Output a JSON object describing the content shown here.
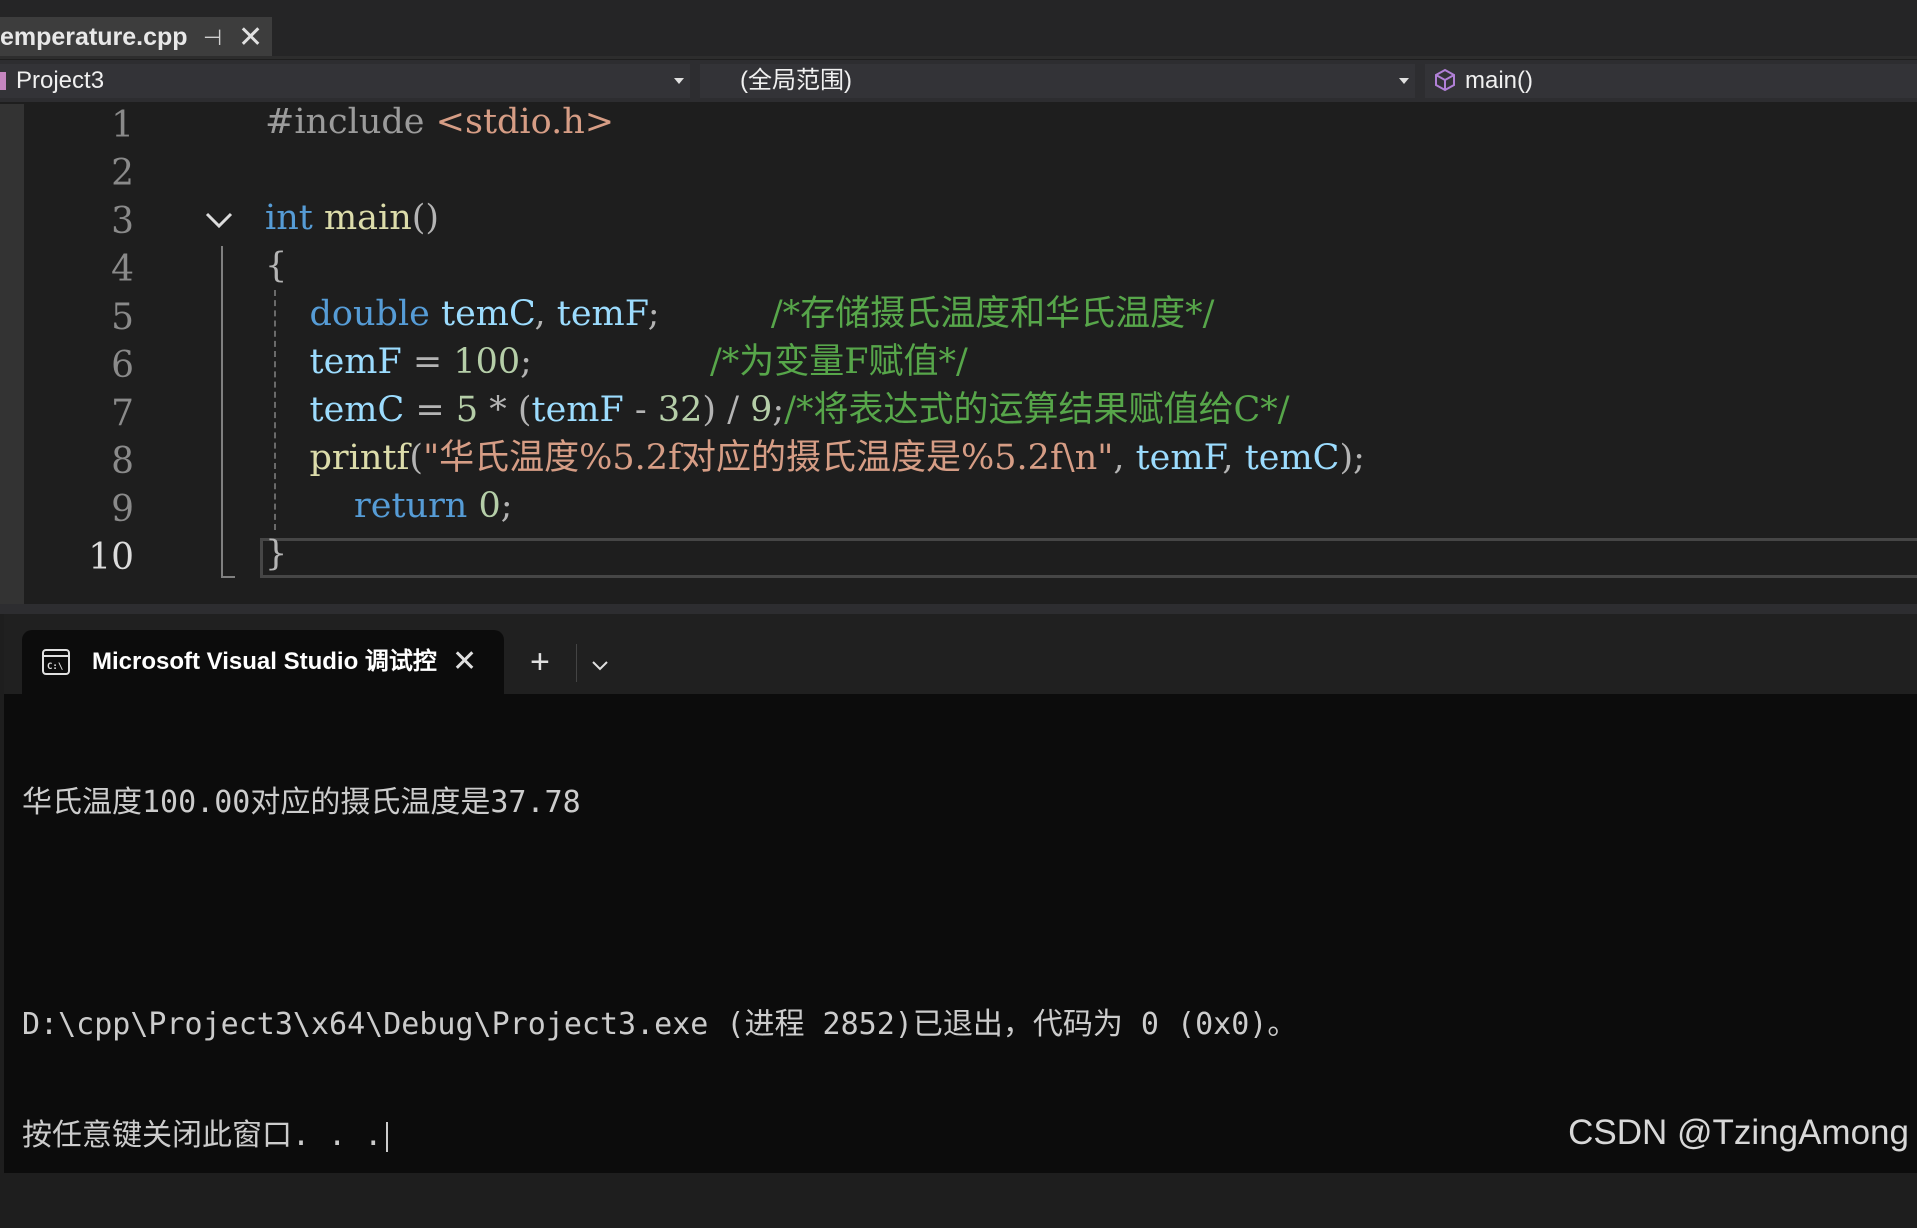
{
  "editor_tab": {
    "filename": "emperature.cpp",
    "pin_glyph": "⊣",
    "close_glyph": "✕"
  },
  "nav": {
    "project": "Project3",
    "scope": "(全局范围)",
    "member": "main()"
  },
  "editor": {
    "line_numbers": [
      "1",
      "2",
      "3",
      "4",
      "5",
      "6",
      "7",
      "8",
      "9",
      "10"
    ],
    "current_line": 10,
    "lines": [
      [
        {
          "t": "#include ",
          "c": "pp"
        },
        {
          "t": "<stdio.h>",
          "c": "inc"
        }
      ],
      [],
      [
        {
          "t": "int",
          "c": "kw"
        },
        {
          "t": " ",
          "c": "punc"
        },
        {
          "t": "main",
          "c": "fn"
        },
        {
          "t": "()",
          "c": "punc"
        }
      ],
      [
        {
          "t": "{",
          "c": "punc"
        }
      ],
      [
        {
          "t": "    ",
          "c": "punc"
        },
        {
          "t": "double",
          "c": "kw"
        },
        {
          "t": " ",
          "c": "punc"
        },
        {
          "t": "temC",
          "c": "var"
        },
        {
          "t": ", ",
          "c": "punc"
        },
        {
          "t": "temF",
          "c": "var"
        },
        {
          "t": ";          ",
          "c": "punc"
        },
        {
          "t": "/*存储摄氏温度和华氏温度*/",
          "c": "cm"
        }
      ],
      [
        {
          "t": "    ",
          "c": "punc"
        },
        {
          "t": "temF",
          "c": "var"
        },
        {
          "t": " = ",
          "c": "punc"
        },
        {
          "t": "100",
          "c": "num"
        },
        {
          "t": ";                ",
          "c": "punc"
        },
        {
          "t": "/*为变量F赋值*/",
          "c": "cm"
        }
      ],
      [
        {
          "t": "    ",
          "c": "punc"
        },
        {
          "t": "temC",
          "c": "var"
        },
        {
          "t": " = ",
          "c": "punc"
        },
        {
          "t": "5",
          "c": "num"
        },
        {
          "t": " * (",
          "c": "punc"
        },
        {
          "t": "temF",
          "c": "var"
        },
        {
          "t": " - ",
          "c": "punc"
        },
        {
          "t": "32",
          "c": "num"
        },
        {
          "t": ") / ",
          "c": "punc"
        },
        {
          "t": "9",
          "c": "num"
        },
        {
          "t": ";",
          "c": "punc"
        },
        {
          "t": "/*将表达式的运算结果赋值给C*/",
          "c": "cm"
        }
      ],
      [
        {
          "t": "    ",
          "c": "punc"
        },
        {
          "t": "printf",
          "c": "fn"
        },
        {
          "t": "(",
          "c": "punc"
        },
        {
          "t": "\"华氏温度%5.2f对应的摄氏温度是%5.2f\\n\"",
          "c": "str"
        },
        {
          "t": ", ",
          "c": "punc"
        },
        {
          "t": "temF",
          "c": "var"
        },
        {
          "t": ", ",
          "c": "punc"
        },
        {
          "t": "temC",
          "c": "var"
        },
        {
          "t": ");",
          "c": "punc"
        }
      ],
      [
        {
          "t": "        ",
          "c": "punc"
        },
        {
          "t": "return",
          "c": "kw"
        },
        {
          "t": " ",
          "c": "punc"
        },
        {
          "t": "0",
          "c": "num"
        },
        {
          "t": ";",
          "c": "punc"
        }
      ],
      [
        {
          "t": "}",
          "c": "punc"
        }
      ]
    ]
  },
  "terminal": {
    "tab_title": "Microsoft Visual Studio 调试控",
    "add_glyph": "+",
    "output": [
      "华氏温度100.00对应的摄氏温度是37.78",
      "",
      "D:\\cpp\\Project3\\x64\\Debug\\Project3.exe (进程 2852)已退出，代码为 0 (0x0)。",
      "按任意键关闭此窗口. . ."
    ]
  },
  "watermark": "CSDN @TzingAmong",
  "colors": {
    "keyword": "#569cd6",
    "function": "#dcdcaa",
    "variable": "#9cdcfe",
    "number": "#b5cea8",
    "string": "#d69d85",
    "comment": "#57a64a"
  }
}
